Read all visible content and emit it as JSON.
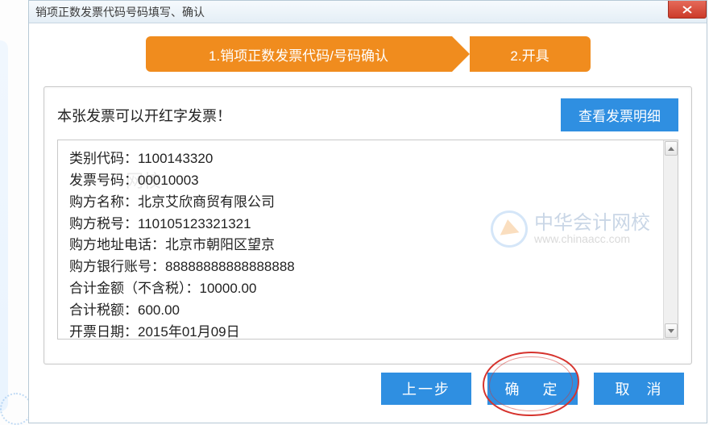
{
  "title": "销项正数发票代码号码填写、确认",
  "steps": {
    "step1": "1.销项正数发票代码/号码确认",
    "step2": "2.开具"
  },
  "notice": "本张发票可以开红字发票！",
  "view_detail_label": "查看发票明细",
  "info": {
    "category_code_label": "类别代码：",
    "category_code_value": "1100143320",
    "invoice_no_label": "发票号码：",
    "invoice_no_value": "00010003",
    "buyer_name_label": "购方名称：",
    "buyer_name_value": "北京艾欣商贸有限公司",
    "buyer_tax_label": "购方税号：",
    "buyer_tax_value": "110105123321321",
    "buyer_addr_label": "购方地址电话：",
    "buyer_addr_value": "北京市朝阳区望京",
    "buyer_bank_label": "购方银行账号：",
    "buyer_bank_value": "88888888888888888",
    "amount_label": "合计金额（不含税）：",
    "amount_value": "10000.00",
    "tax_label": "合计税额：",
    "tax_value": "600.00",
    "date_label": "开票日期：",
    "date_value": "2015年01月09日"
  },
  "buttons": {
    "prev": "上一步",
    "ok": "确 定",
    "cancel": "取 消"
  },
  "watermark_cn": "中华会计网校",
  "watermark_en": "www.chinaacc.com"
}
